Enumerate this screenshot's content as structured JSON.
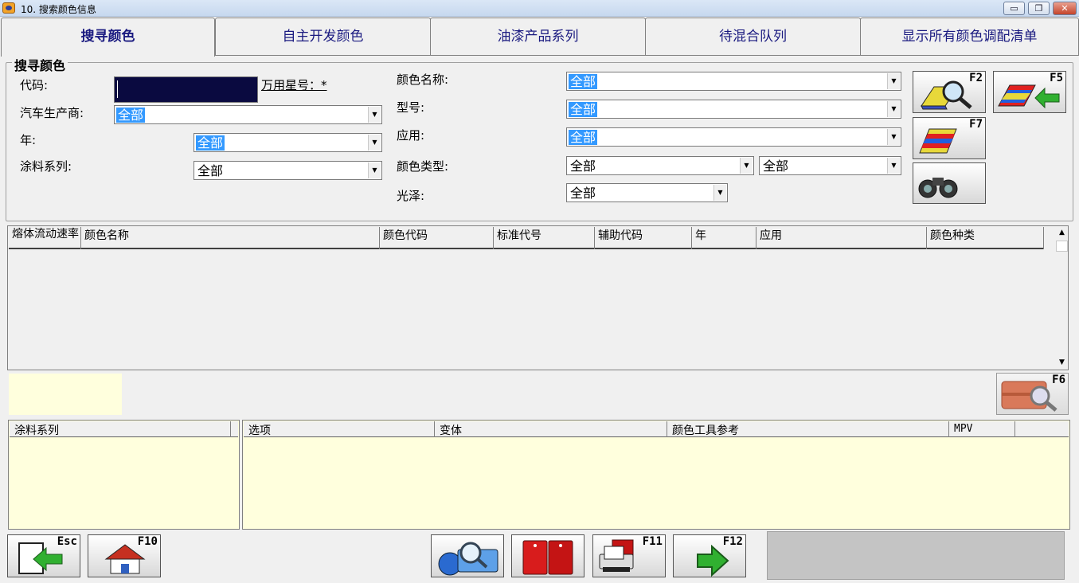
{
  "window": {
    "title": "10. 搜索颜色信息",
    "controls": {
      "minimize": "▭",
      "restore": "❐",
      "close": "✕"
    }
  },
  "tabs": [
    {
      "label": "搜寻颜色",
      "active": true
    },
    {
      "label": "自主开发颜色"
    },
    {
      "label": "油漆产品系列"
    },
    {
      "label": "待混合队列"
    },
    {
      "label": "显示所有颜色调配清单"
    }
  ],
  "search": {
    "group_title": "搜寻颜色",
    "code_label": "代码:",
    "wildcard_label": "万用星号：*",
    "manufacturer_label": "汽车生产商:",
    "manufacturer_value": "全部",
    "year_label": "年:",
    "year_value": "全部",
    "paint_series_label": "涂料系列:",
    "paint_series_value": "全部",
    "color_name_label": "颜色名称:",
    "color_name_value": "全部",
    "model_label": "型号:",
    "model_value": "全部",
    "application_label": "应用:",
    "application_value": "全部",
    "color_type_label": "颜色类型:",
    "color_type_value1": "全部",
    "color_type_value2": "全部",
    "gloss_label": "光泽:",
    "gloss_value": "全部"
  },
  "fkeys": {
    "f2": "F2",
    "f5": "F5",
    "f7": "F7",
    "f6": "F6",
    "esc": "Esc",
    "f10": "F10",
    "f11": "F11",
    "f12": "F12"
  },
  "results": {
    "columns": [
      "熔体流动速率",
      "颜色名称",
      "颜色代码",
      "标准代号",
      "辅助代码",
      "年",
      "应用",
      "颜色种类"
    ],
    "rows": []
  },
  "paint_table": {
    "columns": [
      "涂料系列"
    ]
  },
  "options_table": {
    "columns": [
      "选项",
      "变体",
      "颜色工具参考",
      "MPV",
      ""
    ]
  },
  "colors": {
    "selection": "#3399ff",
    "yellow_panel": "#ffffdd",
    "code_field": "#0a0a40"
  }
}
